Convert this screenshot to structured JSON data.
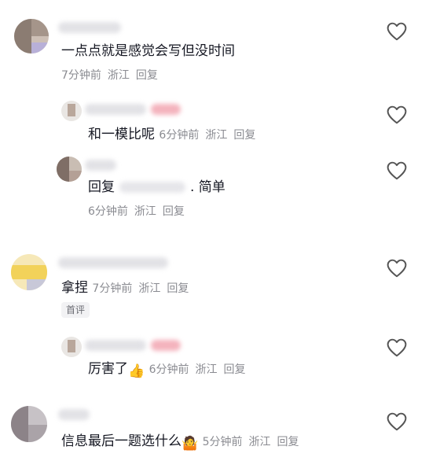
{
  "comments": [
    {
      "text": "一点点就是感觉会写但没时间",
      "time": "7分钟前",
      "location": "浙江",
      "reply": "回复",
      "avatar_icon": "user-avatar-icon"
    },
    {
      "text": "和一模比呢",
      "time": "6分钟前",
      "location": "浙江",
      "reply": "回复",
      "avatar_icon": "user-avatar-icon"
    },
    {
      "prefix": "回复",
      "suffix": ".  简单",
      "time": "6分钟前",
      "location": "浙江",
      "reply": "回复",
      "avatar_icon": "user-avatar-icon"
    },
    {
      "text": "拿捏",
      "time": "7分钟前",
      "location": "浙江",
      "reply": "回复",
      "badge": "首评",
      "avatar_icon": "user-avatar-icon"
    },
    {
      "text": "厉害了",
      "emoji": "👍",
      "time": "6分钟前",
      "location": "浙江",
      "reply": "回复",
      "avatar_icon": "user-avatar-icon"
    },
    {
      "text": "信息最后一题选什么",
      "emoji": "🤷",
      "time": "5分钟前",
      "location": "浙江",
      "reply": "回复",
      "avatar_icon": "user-avatar-icon"
    }
  ],
  "colors": {
    "text": "#161823",
    "meta": "#8a8b91",
    "heart": "#555555",
    "badge_bg": "#f2f2f4"
  }
}
